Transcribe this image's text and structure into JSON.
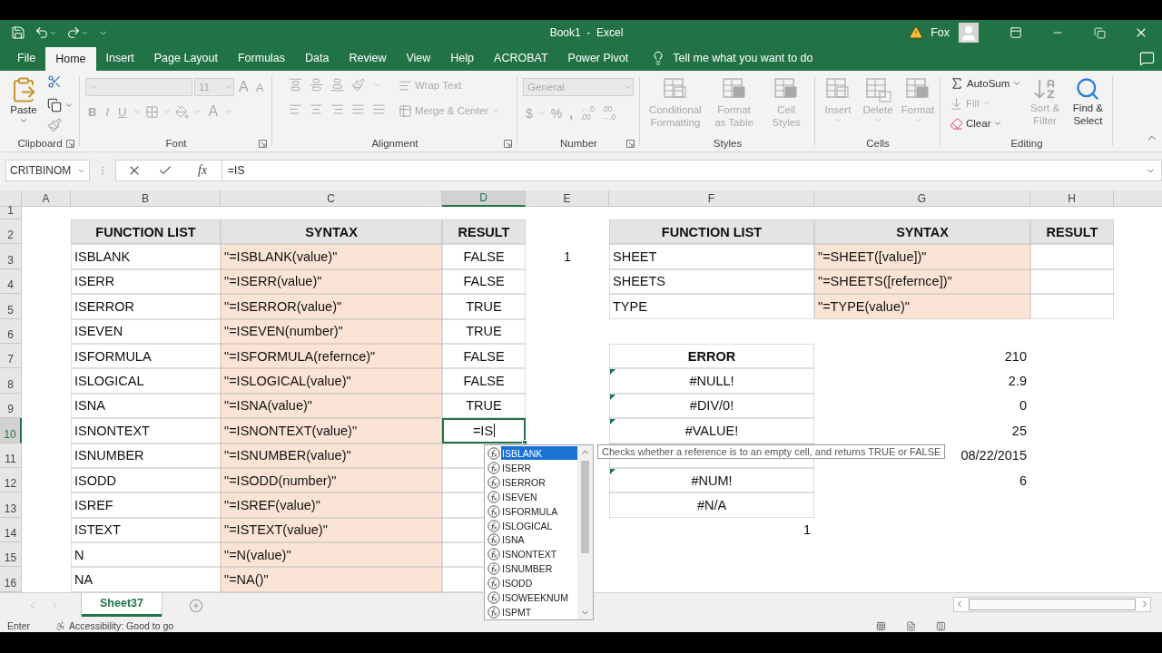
{
  "title_bar": {
    "title": "Book1  -  Excel",
    "user": "Fox"
  },
  "ribbon_tabs": [
    {
      "label": "File",
      "selected": false
    },
    {
      "label": "Home",
      "selected": true
    },
    {
      "label": "Insert",
      "selected": false
    },
    {
      "label": "Page Layout",
      "selected": false
    },
    {
      "label": "Formulas",
      "selected": false
    },
    {
      "label": "Data",
      "selected": false
    },
    {
      "label": "Review",
      "selected": false
    },
    {
      "label": "View",
      "selected": false
    },
    {
      "label": "Help",
      "selected": false
    },
    {
      "label": "ACROBAT",
      "selected": false
    },
    {
      "label": "Power Pivot",
      "selected": false
    }
  ],
  "tell_me": {
    "placeholder": "Tell me what you want to do"
  },
  "ribbon": {
    "clipboard": {
      "label": "Clipboard",
      "paste": {
        "label": "Paste",
        "disabled": false
      },
      "cut": {
        "disabled": false
      },
      "copy": {
        "disabled": false
      },
      "format_painter": {
        "disabled": true
      }
    },
    "font": {
      "label": "Font",
      "disabled": true,
      "size": "11",
      "grow": "A",
      "shrink": "A",
      "bold": "B",
      "italic": "I",
      "underline": "U",
      "font_color": "A"
    },
    "alignment": {
      "label": "Alignment",
      "disabled": true,
      "wrap_text": "Wrap Text",
      "merge": "Merge & Center"
    },
    "number": {
      "label": "Number",
      "disabled": true,
      "format": "General",
      "currency": "$",
      "percent": "%",
      "comma": ",",
      "more_decimals": [
        "←.0",
        ".00"
      ],
      "fewer_decimals": [
        ".00",
        "→.0"
      ]
    },
    "styles": {
      "label": "Styles",
      "buttons": [
        {
          "kind": "conditional",
          "label": "Conditional Formatting",
          "disabled": true
        },
        {
          "kind": "table",
          "label": "Format as Table",
          "disabled": true
        },
        {
          "kind": "cell",
          "label": "Cell Styles",
          "disabled": true
        }
      ]
    },
    "cells": {
      "label": "Cells",
      "buttons": [
        {
          "kind": "insert",
          "label": "Insert",
          "disabled": true
        },
        {
          "kind": "delete",
          "label": "Delete",
          "disabled": true
        },
        {
          "kind": "format",
          "label": "Format",
          "disabled": true
        }
      ]
    },
    "editing": {
      "label": "Editing",
      "autosum": {
        "label": "AutoSum",
        "disabled": false
      },
      "fill": {
        "label": "Fill",
        "disabled": true
      },
      "clear": {
        "label": "Clear",
        "disabled": false
      },
      "sort": {
        "label": "Sort & Filter",
        "disabled": true
      },
      "find": {
        "label": "Find & Select",
        "disabled": false
      }
    }
  },
  "formula_bar": {
    "name_box": "CRITBINOM",
    "function_button": "fx",
    "formula": "=IS"
  },
  "sheet": {
    "columns": [
      {
        "label": "A",
        "selected": false
      },
      {
        "label": "B",
        "selected": false
      },
      {
        "label": "C",
        "selected": false
      },
      {
        "label": "D",
        "selected": true
      },
      {
        "label": "E",
        "selected": false
      },
      {
        "label": "F",
        "selected": false
      },
      {
        "label": "G",
        "selected": false
      },
      {
        "label": "H",
        "selected": false
      }
    ],
    "rows": [
      {
        "number": "1",
        "selected": false
      },
      {
        "number": "2",
        "selected": false,
        "cells": {
          "b": {
            "kind": "header",
            "text": "FUNCTION LIST"
          },
          "c": {
            "kind": "header",
            "text": "SYNTAX"
          },
          "d": {
            "kind": "header",
            "text": "RESULT"
          },
          "f": {
            "kind": "header",
            "text": "FUNCTION LIST"
          },
          "g": {
            "kind": "header",
            "text": "SYNTAX"
          },
          "h": {
            "kind": "header",
            "text": "RESULT"
          }
        }
      },
      {
        "number": "3",
        "selected": false,
        "cells": {
          "b": {
            "kind": "name",
            "text": "ISBLANK"
          },
          "c": {
            "kind": "syntax",
            "text": "\"=ISBLANK(value)\""
          },
          "d": {
            "kind": "result",
            "text": "FALSE"
          },
          "e": {
            "kind": "value_center",
            "text": "1"
          },
          "f": {
            "kind": "name",
            "text": "SHEET"
          },
          "g": {
            "kind": "syntax",
            "text": "\"=SHEET([value])\""
          },
          "h": {
            "kind": "blank"
          }
        }
      },
      {
        "number": "4",
        "selected": false,
        "cells": {
          "b": {
            "kind": "name",
            "text": "ISERR"
          },
          "c": {
            "kind": "syntax",
            "text": "\"=ISERR(value)\""
          },
          "d": {
            "kind": "result",
            "text": "FALSE"
          },
          "f": {
            "kind": "name",
            "text": "SHEETS"
          },
          "g": {
            "kind": "syntax",
            "text": "\"=SHEETS([refernce])\""
          },
          "h": {
            "kind": "blank"
          }
        }
      },
      {
        "number": "5",
        "selected": false,
        "cells": {
          "b": {
            "kind": "name",
            "text": "ISERROR"
          },
          "c": {
            "kind": "syntax",
            "text": "\"=ISERROR(value)\""
          },
          "d": {
            "kind": "result",
            "text": "TRUE"
          },
          "f": {
            "kind": "name",
            "text": "TYPE"
          },
          "g": {
            "kind": "syntax",
            "text": "\"=TYPE(value)\""
          },
          "h": {
            "kind": "blank"
          }
        }
      },
      {
        "number": "6",
        "selected": false,
        "cells": {
          "b": {
            "kind": "name",
            "text": "ISEVEN"
          },
          "c": {
            "kind": "syntax",
            "text": "\"=ISEVEN(number)\""
          },
          "d": {
            "kind": "result",
            "text": "TRUE"
          }
        }
      },
      {
        "number": "7",
        "selected": false,
        "cells": {
          "b": {
            "kind": "name",
            "text": "ISFORMULA"
          },
          "c": {
            "kind": "syntax",
            "text": "\"=ISFORMULA(refernce)\""
          },
          "d": {
            "kind": "result",
            "text": "FALSE"
          },
          "f": {
            "kind": "error_header",
            "text": "ERROR"
          },
          "g": {
            "kind": "value",
            "text": "210"
          }
        }
      },
      {
        "number": "8",
        "selected": false,
        "cells": {
          "b": {
            "kind": "name",
            "text": "ISLOGICAL"
          },
          "c": {
            "kind": "syntax",
            "text": "\"=ISLOGICAL(value)\""
          },
          "d": {
            "kind": "result",
            "text": "FALSE"
          },
          "f": {
            "kind": "error",
            "text": "#NULL!",
            "flag": true
          },
          "g": {
            "kind": "value",
            "text": "2.9"
          }
        }
      },
      {
        "number": "9",
        "selected": false,
        "cells": {
          "b": {
            "kind": "name",
            "text": "ISNA"
          },
          "c": {
            "kind": "syntax",
            "text": "\"=ISNA(value)\""
          },
          "d": {
            "kind": "result",
            "text": "TRUE"
          },
          "f": {
            "kind": "error",
            "text": "#DIV/0!",
            "flag": true
          },
          "g": {
            "kind": "value",
            "text": "0"
          }
        }
      },
      {
        "number": "10",
        "selected": true,
        "cells": {
          "b": {
            "kind": "name",
            "text": "ISNONTEXT"
          },
          "c": {
            "kind": "syntax",
            "text": "\"=ISNONTEXT(value)\""
          },
          "d": {
            "kind": "editing",
            "text": "=IS"
          },
          "f": {
            "kind": "error",
            "text": "#VALUE!",
            "flag": true
          },
          "g": {
            "kind": "value",
            "text": "25"
          }
        }
      },
      {
        "number": "11",
        "selected": false,
        "cells": {
          "b": {
            "kind": "name",
            "text": "ISNUMBER"
          },
          "c": {
            "kind": "syntax",
            "text": "\"=ISNUMBER(value)\""
          },
          "d": {
            "kind": "blank"
          },
          "f": {
            "kind": "blank"
          },
          "g": {
            "kind": "value",
            "text": "08/22/2015"
          }
        }
      },
      {
        "number": "12",
        "selected": false,
        "cells": {
          "b": {
            "kind": "name",
            "text": "ISODD"
          },
          "c": {
            "kind": "syntax",
            "text": "\"=ISODD(number)\""
          },
          "d": {
            "kind": "blank"
          },
          "f": {
            "kind": "error",
            "text": "#NUM!",
            "flag": true
          },
          "g": {
            "kind": "value",
            "text": "6"
          }
        }
      },
      {
        "number": "13",
        "selected": false,
        "cells": {
          "b": {
            "kind": "name",
            "text": "ISREF"
          },
          "c": {
            "kind": "syntax",
            "text": "\"=ISREF(value)\""
          },
          "d": {
            "kind": "blank"
          },
          "f": {
            "kind": "error",
            "text": "#N/A"
          }
        }
      },
      {
        "number": "14",
        "selected": false,
        "cells": {
          "b": {
            "kind": "name",
            "text": "ISTEXT"
          },
          "c": {
            "kind": "syntax",
            "text": "\"=ISTEXT(value)\""
          },
          "d": {
            "kind": "blank"
          },
          "f": {
            "kind": "value",
            "text": "1"
          }
        }
      },
      {
        "number": "15",
        "selected": false,
        "cells": {
          "b": {
            "kind": "name",
            "text": "N"
          },
          "c": {
            "kind": "syntax",
            "text": "\"=N(value)\""
          },
          "d": {
            "kind": "blank"
          }
        }
      },
      {
        "number": "16",
        "selected": false,
        "cells": {
          "b": {
            "kind": "name",
            "text": "NA"
          },
          "c": {
            "kind": "syntax",
            "text": "\"=NA()\""
          },
          "d": {
            "kind": "blank"
          }
        }
      }
    ]
  },
  "autocomplete": {
    "items": [
      {
        "label": "ISBLANK",
        "selected": true
      },
      {
        "label": "ISERR",
        "selected": false
      },
      {
        "label": "ISERROR",
        "selected": false
      },
      {
        "label": "ISEVEN",
        "selected": false
      },
      {
        "label": "ISFORMULA",
        "selected": false
      },
      {
        "label": "ISLOGICAL",
        "selected": false
      },
      {
        "label": "ISNA",
        "selected": false
      },
      {
        "label": "ISNONTEXT",
        "selected": false
      },
      {
        "label": "ISNUMBER",
        "selected": false
      },
      {
        "label": "ISODD",
        "selected": false
      },
      {
        "label": "ISOWEEKNUM",
        "selected": false
      },
      {
        "label": "ISPMT",
        "selected": false
      }
    ],
    "tooltip": "Checks whether a reference is to an empty cell, and returns TRUE or FALSE"
  },
  "sheet_tabs": [
    {
      "label": "Sheet37",
      "selected": true
    }
  ],
  "status_bar": {
    "mode": "Enter",
    "accessibility": "Accessibility: Good to go"
  }
}
